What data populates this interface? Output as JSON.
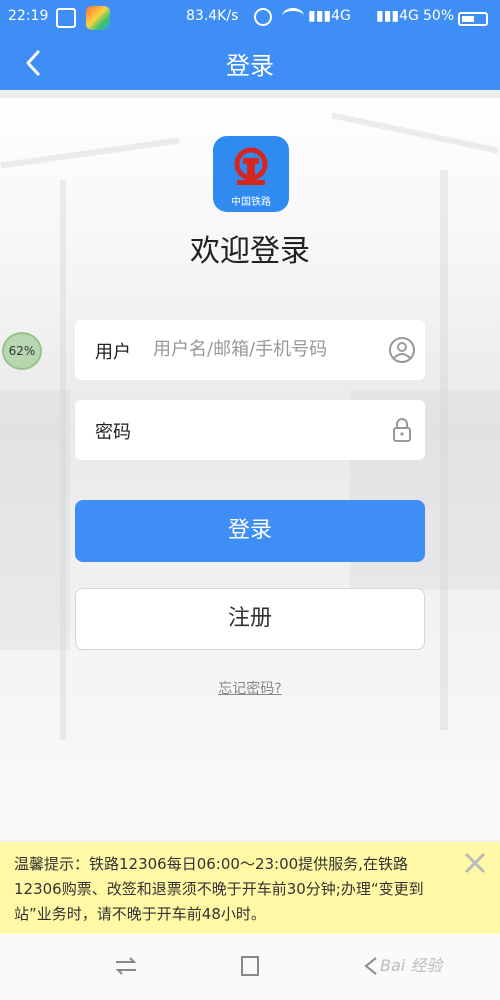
{
  "status_bar": {
    "time": "22:19",
    "speed": "83.4K/s",
    "signal_1": "4G",
    "signal_2": "4G",
    "battery": "50%"
  },
  "header": {
    "title": "登录"
  },
  "logo": {
    "label": "中国铁路"
  },
  "welcome": "欢迎登录",
  "floating_badge": "62%",
  "form": {
    "username_label": "用户",
    "username_placeholder": "用户名/邮箱/手机号码",
    "password_label": "密码",
    "password_placeholder": ""
  },
  "buttons": {
    "login": "登录",
    "register": "注册",
    "forgot": "忘记密码?"
  },
  "notice": {
    "text": "温馨提示：铁路12306每日06:00～23:00提供服务,在铁路12306购票、改签和退票须不晚于开车前30分钟;办理“变更到站”业务时，请不晚于开车前48小时。"
  },
  "watermark": "Bai 经验",
  "colors": {
    "accent": "#3f8ef5",
    "notice_bg": "#fff9a6"
  }
}
